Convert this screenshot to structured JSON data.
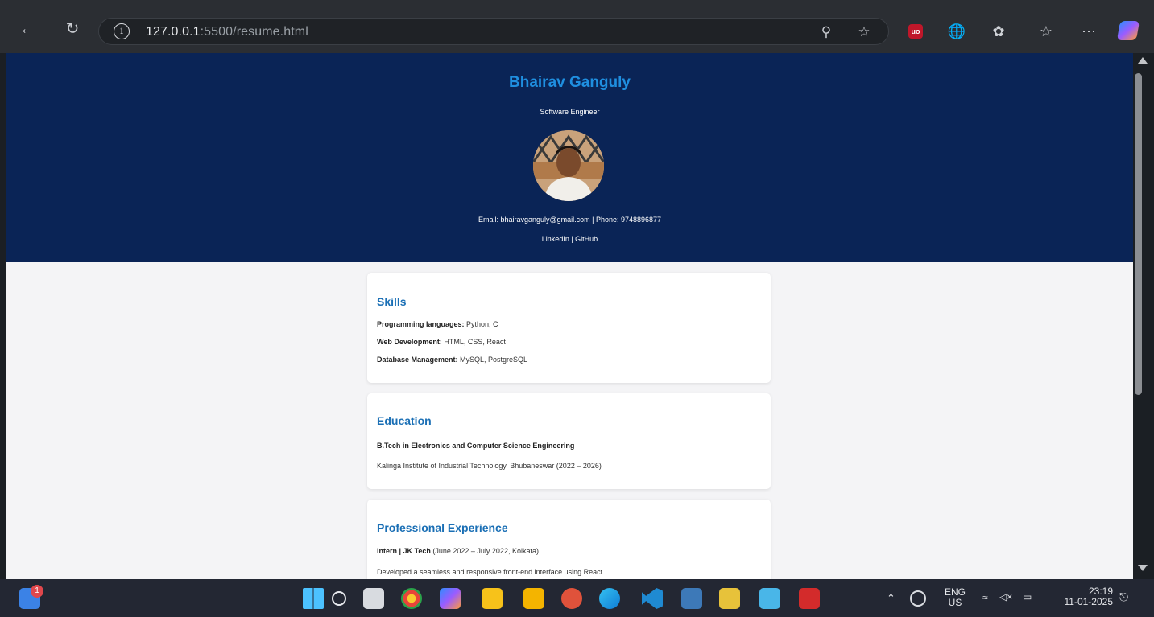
{
  "browser": {
    "url_host": "127.0.0.1",
    "url_path": ":5500/resume.html"
  },
  "resume": {
    "name": "Bhairav Ganguly",
    "title": "Software Engineer",
    "contact": "Email: bhairavganguly@gmail.com | Phone: 9748896877",
    "links": "LinkedIn | GitHub",
    "skills": {
      "heading": "Skills",
      "items": [
        {
          "label": "Programming languages:",
          "value": " Python, C"
        },
        {
          "label": "Web Development:",
          "value": " HTML, CSS, React"
        },
        {
          "label": "Database Management:",
          "value": " MySQL, PostgreSQL"
        }
      ]
    },
    "education": {
      "heading": "Education",
      "degree": "B.Tech in Electronics and Computer Science Engineering",
      "institution": "Kalinga Institute of Industrial Technology, Bhubaneswar (2022 – 2026)"
    },
    "experience": {
      "heading": "Professional Experience",
      "role": "Intern | JK Tech",
      "role_detail": " (June 2022 – July 2022, Kolkata)",
      "description": "Developed a seamless and responsive front-end interface using React."
    }
  },
  "taskbar": {
    "notification_badge": "1",
    "lang_primary": "ENG",
    "lang_secondary": "US",
    "time": "23:19",
    "date": "11-01-2025"
  }
}
